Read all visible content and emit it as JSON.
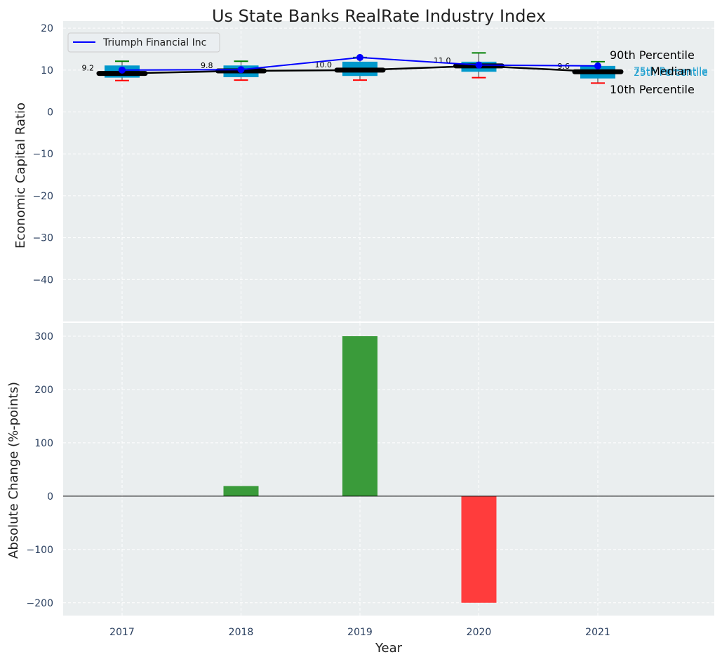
{
  "chart_data": [
    {
      "type": "box+line",
      "title": "Us State Banks RealRate Industry Index",
      "ylabel": "Economic Capital Ratio",
      "ylim": [
        -50,
        21.7
      ],
      "yticks": [
        20,
        10,
        0,
        -10,
        -20,
        -30,
        -40
      ],
      "categories": [
        "2017",
        "2018",
        "2019",
        "2020",
        "2021"
      ],
      "percentiles": {
        "p10": [
          7.5,
          7.6,
          7.6,
          8.2,
          6.9
        ],
        "p25": [
          8.2,
          8.3,
          8.6,
          9.6,
          8.0
        ],
        "median": [
          9.2,
          9.8,
          10.0,
          11.0,
          9.6
        ],
        "p75": [
          11.1,
          11.1,
          12.0,
          12.0,
          11.0
        ],
        "p90": [
          12.1,
          12.1,
          13.0,
          14.1,
          12.0
        ]
      },
      "median_labels": [
        "9.2",
        "9.8",
        "10.0",
        "11.0",
        "9.6"
      ],
      "series": [
        {
          "name": "Triumph Financial Inc",
          "values": [
            10.0,
            10.1,
            13.0,
            11.2,
            11.0
          ],
          "color": "#0000ff"
        }
      ],
      "legend": "top-left",
      "annotations": [
        "90th Percentile",
        "75th Percentile",
        "Median",
        "25th Percentile",
        "10th Percentile"
      ]
    },
    {
      "type": "bar",
      "ylabel": "Absolute Change (%-points)",
      "xlabel": "Year",
      "ylim": [
        -224,
        325
      ],
      "yticks": [
        300,
        200,
        100,
        0,
        -100,
        -200
      ],
      "categories": [
        "2017",
        "2018",
        "2019",
        "2020",
        "2021"
      ],
      "values": [
        0,
        19,
        300,
        -200,
        0
      ],
      "colors": {
        "positive": "#3a9b3a",
        "negative": "#ff3c3c"
      }
    }
  ]
}
